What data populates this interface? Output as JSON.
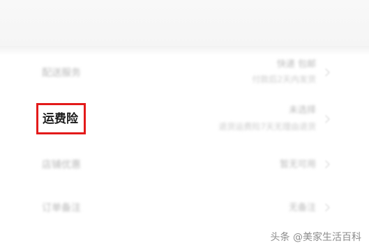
{
  "rows": [
    {
      "label": "配送服务",
      "value_main": "快递 包邮",
      "value_sub": "付款后2天内发货",
      "chevron_icon": "chevron-right-icon"
    },
    {
      "label": "运费险",
      "value_main": "未选择",
      "value_sub": "退货运费险7天无理由退货",
      "chevron_icon": "chevron-right-icon"
    },
    {
      "label": "店铺优惠",
      "value_main": "暂无可用",
      "value_sub": "",
      "chevron_icon": "chevron-right-icon"
    },
    {
      "label": "订单备注",
      "value_main": "无备注",
      "value_sub": "",
      "chevron_icon": "chevron-right-icon"
    }
  ],
  "watermark": "头条 @美家生活百科",
  "colors": {
    "highlight_border": "#e31a1a",
    "highlight_text": "#1b1b1b",
    "blurred_text": "#b9b9b9",
    "watermark_text": "#8c8c8c"
  }
}
